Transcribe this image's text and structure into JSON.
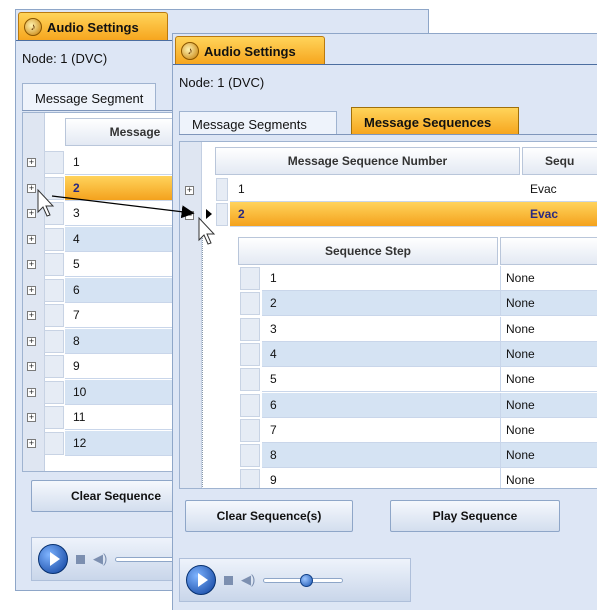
{
  "back_window": {
    "title": "Audio Settings",
    "node": "Node: 1 (DVC)",
    "tab_segments": "Message Segment",
    "grid_header": "Message",
    "rows": [
      "1",
      "2",
      "3",
      "4",
      "5",
      "6",
      "7",
      "8",
      "9",
      "10",
      "11",
      "12"
    ],
    "selected_row": "2",
    "clear_button": "Clear Sequence"
  },
  "front_window": {
    "title": "Audio Settings",
    "node": "Node: 1 (DVC)",
    "tab_segments": "Message Segments",
    "tab_sequences": "Message Sequences",
    "col_number": "Message Sequence Number",
    "col_seq": "Sequ",
    "sequences": [
      {
        "number": "1",
        "name": "Evac"
      },
      {
        "number": "2",
        "name": "Evac"
      }
    ],
    "selected_sequence": "2",
    "sub_header_step": "Sequence Step",
    "steps": [
      {
        "step": "1",
        "value": "None"
      },
      {
        "step": "2",
        "value": "None"
      },
      {
        "step": "3",
        "value": "None"
      },
      {
        "step": "4",
        "value": "None"
      },
      {
        "step": "5",
        "value": "None"
      },
      {
        "step": "6",
        "value": "None"
      },
      {
        "step": "7",
        "value": "None"
      },
      {
        "step": "8",
        "value": "None"
      },
      {
        "step": "9",
        "value": "None"
      }
    ],
    "clear_button": "Clear Sequence(s)",
    "play_button": "Play Sequence"
  },
  "colors": {
    "accent_orange": "#f6a41c",
    "panel_blue": "#dde6f5",
    "row_alt": "#d5e3f3"
  },
  "icons": [
    "audio-settings-icon",
    "expand-icon",
    "collapse-icon",
    "row-pointer-icon",
    "play-icon",
    "stop-icon",
    "volume-icon",
    "mouse-cursor-icon"
  ]
}
